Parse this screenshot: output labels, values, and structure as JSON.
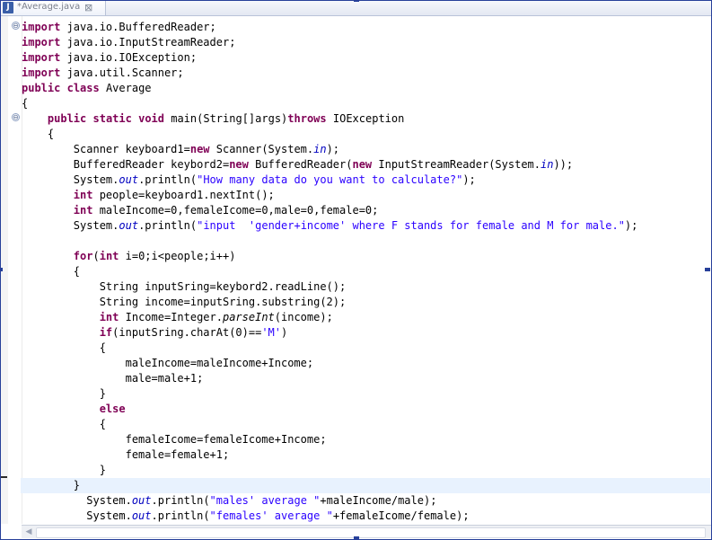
{
  "editor_tab": {
    "title": "*Average.java",
    "icon": "java-file-icon",
    "close_glyph": "⊠"
  },
  "fold_glyph": "⊖",
  "colors": {
    "keyword": "#7f0055",
    "string": "#2a00ff",
    "static_field": "#0000c0",
    "current_line": "#e8f2fe",
    "frame": "#27409a"
  },
  "code": {
    "line01": [
      {
        "t": "import",
        "c": "kw"
      },
      {
        "t": " java.io.BufferedReader;"
      }
    ],
    "line02": [
      {
        "t": "import",
        "c": "kw"
      },
      {
        "t": " java.io.InputStreamReader;"
      }
    ],
    "line03": [
      {
        "t": "import",
        "c": "kw"
      },
      {
        "t": " java.io.IOException;"
      }
    ],
    "line04": [
      {
        "t": "import",
        "c": "kw"
      },
      {
        "t": " java.util.Scanner;"
      }
    ],
    "line05": [
      {
        "t": "public",
        "c": "kw"
      },
      {
        "t": " "
      },
      {
        "t": "class",
        "c": "kw"
      },
      {
        "t": " Average"
      }
    ],
    "line06": [
      {
        "t": "{"
      }
    ],
    "line07": [
      {
        "t": "    "
      },
      {
        "t": "public",
        "c": "kw"
      },
      {
        "t": " "
      },
      {
        "t": "static",
        "c": "kw"
      },
      {
        "t": " "
      },
      {
        "t": "void",
        "c": "kw"
      },
      {
        "t": " main(String[]args)"
      },
      {
        "t": "throws",
        "c": "kw"
      },
      {
        "t": " IOException"
      }
    ],
    "line08": [
      {
        "t": "    {"
      }
    ],
    "line09": [
      {
        "t": "        Scanner keyboard1="
      },
      {
        "t": "new",
        "c": "kw"
      },
      {
        "t": " Scanner(System."
      },
      {
        "t": "in",
        "c": "ital"
      },
      {
        "t": ");"
      }
    ],
    "line10": [
      {
        "t": "        BufferedReader keybord2="
      },
      {
        "t": "new",
        "c": "kw"
      },
      {
        "t": " BufferedReader("
      },
      {
        "t": "new",
        "c": "kw"
      },
      {
        "t": " InputStreamReader(System."
      },
      {
        "t": "in",
        "c": "ital"
      },
      {
        "t": "));"
      }
    ],
    "line11": [
      {
        "t": "        System."
      },
      {
        "t": "out",
        "c": "ital"
      },
      {
        "t": ".println("
      },
      {
        "t": "\"How many data do you want to calculate?\"",
        "c": "str"
      },
      {
        "t": ");"
      }
    ],
    "line12": [
      {
        "t": "        "
      },
      {
        "t": "int",
        "c": "kw"
      },
      {
        "t": " people=keyboard1.nextInt();"
      }
    ],
    "line13": [
      {
        "t": "        "
      },
      {
        "t": "int",
        "c": "kw"
      },
      {
        "t": " maleIncome=0,femaleIcome=0,male=0,female=0;"
      }
    ],
    "line14": [
      {
        "t": "        System."
      },
      {
        "t": "out",
        "c": "ital"
      },
      {
        "t": ".println("
      },
      {
        "t": "\"input  'gender+income' where F stands for female and M for male.\"",
        "c": "str"
      },
      {
        "t": ");"
      }
    ],
    "line15": [
      {
        "t": ""
      }
    ],
    "line16": [
      {
        "t": "        "
      },
      {
        "t": "for",
        "c": "kw"
      },
      {
        "t": "("
      },
      {
        "t": "int",
        "c": "kw"
      },
      {
        "t": " i=0;i<people;i++)"
      }
    ],
    "line17": [
      {
        "t": "        {"
      }
    ],
    "line18": [
      {
        "t": "            String inputSring=keybord2.readLine();"
      }
    ],
    "line19": [
      {
        "t": "            String income=inputSring.substring(2);"
      }
    ],
    "line20": [
      {
        "t": "            "
      },
      {
        "t": "int",
        "c": "kw"
      },
      {
        "t": " Income=Integer."
      },
      {
        "t": "parseInt",
        "c": "mth"
      },
      {
        "t": "(income);"
      }
    ],
    "line21": [
      {
        "t": "            "
      },
      {
        "t": "if",
        "c": "kw"
      },
      {
        "t": "(inputSring.charAt(0)=="
      },
      {
        "t": "'M'",
        "c": "str"
      },
      {
        "t": ")"
      }
    ],
    "line22": [
      {
        "t": "            {"
      }
    ],
    "line23": [
      {
        "t": "                maleIncome=maleIncome+Income;"
      }
    ],
    "line24": [
      {
        "t": "                male=male+1;"
      }
    ],
    "line25": [
      {
        "t": "            }"
      }
    ],
    "line26": [
      {
        "t": "            "
      },
      {
        "t": "else",
        "c": "kw"
      }
    ],
    "line27": [
      {
        "t": "            {"
      }
    ],
    "line28": [
      {
        "t": "                femaleIcome=femaleIcome+Income;"
      }
    ],
    "line29": [
      {
        "t": "                female=female+1;"
      }
    ],
    "line30": [
      {
        "t": "            }"
      }
    ],
    "line31": [
      {
        "t": "        }"
      }
    ],
    "line32": [
      {
        "t": "          System."
      },
      {
        "t": "out",
        "c": "ital"
      },
      {
        "t": ".println("
      },
      {
        "t": "\"males' average \"",
        "c": "str"
      },
      {
        "t": "+maleIncome/male);"
      }
    ],
    "line33": [
      {
        "t": "          System."
      },
      {
        "t": "out",
        "c": "ital"
      },
      {
        "t": ".println("
      },
      {
        "t": "\"females' average \"",
        "c": "str"
      },
      {
        "t": "+femaleIcome/female);"
      }
    ]
  },
  "current_line": "line31"
}
